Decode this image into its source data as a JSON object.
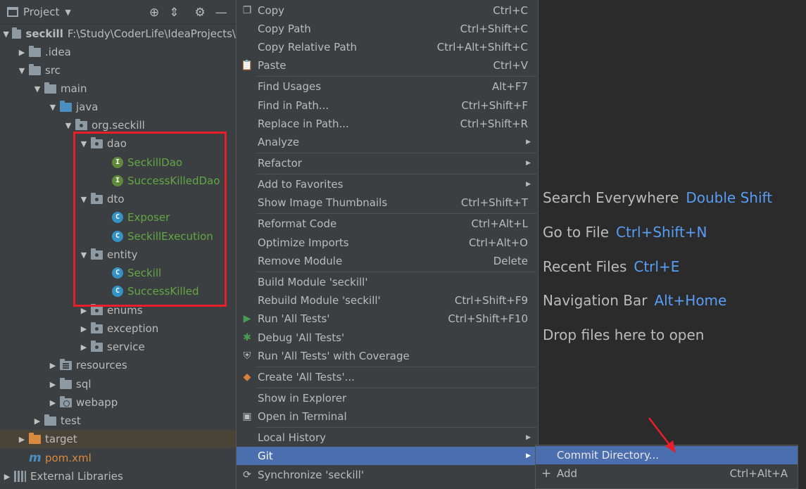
{
  "project_panel": {
    "title": "Project",
    "tree": [
      {
        "label": "seckill",
        "sub": "F:\\Study\\CoderLife\\IdeaProjects\\",
        "bold": true
      },
      {
        "label": ".idea"
      },
      {
        "label": "src"
      },
      {
        "label": "main"
      },
      {
        "label": "java"
      },
      {
        "label": "org.seckill"
      },
      {
        "label": "dao"
      },
      {
        "label": "SeckillDao"
      },
      {
        "label": "SuccessKilledDao"
      },
      {
        "label": "dto"
      },
      {
        "label": "Exposer"
      },
      {
        "label": "SeckillExecution"
      },
      {
        "label": "entity"
      },
      {
        "label": "Seckill"
      },
      {
        "label": "SuccessKilled"
      },
      {
        "label": "enums"
      },
      {
        "label": "exception"
      },
      {
        "label": "service"
      },
      {
        "label": "resources"
      },
      {
        "label": "sql"
      },
      {
        "label": "webapp"
      },
      {
        "label": "test"
      },
      {
        "label": "target"
      },
      {
        "label": "pom.xml"
      },
      {
        "label": "External Libraries"
      }
    ]
  },
  "context_menu": {
    "items": [
      {
        "label": "Copy",
        "shortcut": "Ctrl+C"
      },
      {
        "label": "Copy Path",
        "shortcut": "Ctrl+Shift+C"
      },
      {
        "label": "Copy Relative Path",
        "shortcut": "Ctrl+Alt+Shift+C"
      },
      {
        "label": "Paste",
        "shortcut": "Ctrl+V"
      },
      {
        "label": "Find Usages",
        "shortcut": "Alt+F7"
      },
      {
        "label": "Find in Path...",
        "shortcut": "Ctrl+Shift+F"
      },
      {
        "label": "Replace in Path...",
        "shortcut": "Ctrl+Shift+R"
      },
      {
        "label": "Analyze",
        "shortcut": ""
      },
      {
        "label": "Refactor",
        "shortcut": ""
      },
      {
        "label": "Add to Favorites",
        "shortcut": ""
      },
      {
        "label": "Show Image Thumbnails",
        "shortcut": "Ctrl+Shift+T"
      },
      {
        "label": "Reformat Code",
        "shortcut": "Ctrl+Alt+L"
      },
      {
        "label": "Optimize Imports",
        "shortcut": "Ctrl+Alt+O"
      },
      {
        "label": "Remove Module",
        "shortcut": "Delete"
      },
      {
        "label": "Build Module 'seckill'",
        "shortcut": ""
      },
      {
        "label": "Rebuild Module 'seckill'",
        "shortcut": "Ctrl+Shift+F9"
      },
      {
        "label": "Run 'All Tests'",
        "shortcut": "Ctrl+Shift+F10"
      },
      {
        "label": "Debug 'All Tests'",
        "shortcut": ""
      },
      {
        "label": "Run 'All Tests' with Coverage",
        "shortcut": ""
      },
      {
        "label": "Create 'All Tests'...",
        "shortcut": ""
      },
      {
        "label": "Show in Explorer",
        "shortcut": ""
      },
      {
        "label": "Open in Terminal",
        "shortcut": ""
      },
      {
        "label": "Local History",
        "shortcut": ""
      },
      {
        "label": "Git",
        "shortcut": ""
      },
      {
        "label": "Synchronize 'seckill'",
        "shortcut": ""
      }
    ]
  },
  "git_submenu": {
    "items": [
      {
        "label": "Commit Directory...",
        "shortcut": ""
      },
      {
        "label": "Add",
        "shortcut": "Ctrl+Alt+A"
      }
    ]
  },
  "editor_hints": [
    {
      "label": "Search Everywhere",
      "key": "Double Shift"
    },
    {
      "label": "Go to File",
      "key": "Ctrl+Shift+N"
    },
    {
      "label": "Recent Files",
      "key": "Ctrl+E"
    },
    {
      "label": "Navigation Bar",
      "key": "Alt+Home"
    },
    {
      "label": "Drop files here to open",
      "key": ""
    }
  ],
  "colors": {
    "menu_bg": "#3c3f41",
    "editor_bg": "#2b2b2b",
    "selection": "#4b6eaf",
    "shortcut_key": "#589df6",
    "highlight_box": "#e81e2b",
    "class_name": "#62a744"
  }
}
